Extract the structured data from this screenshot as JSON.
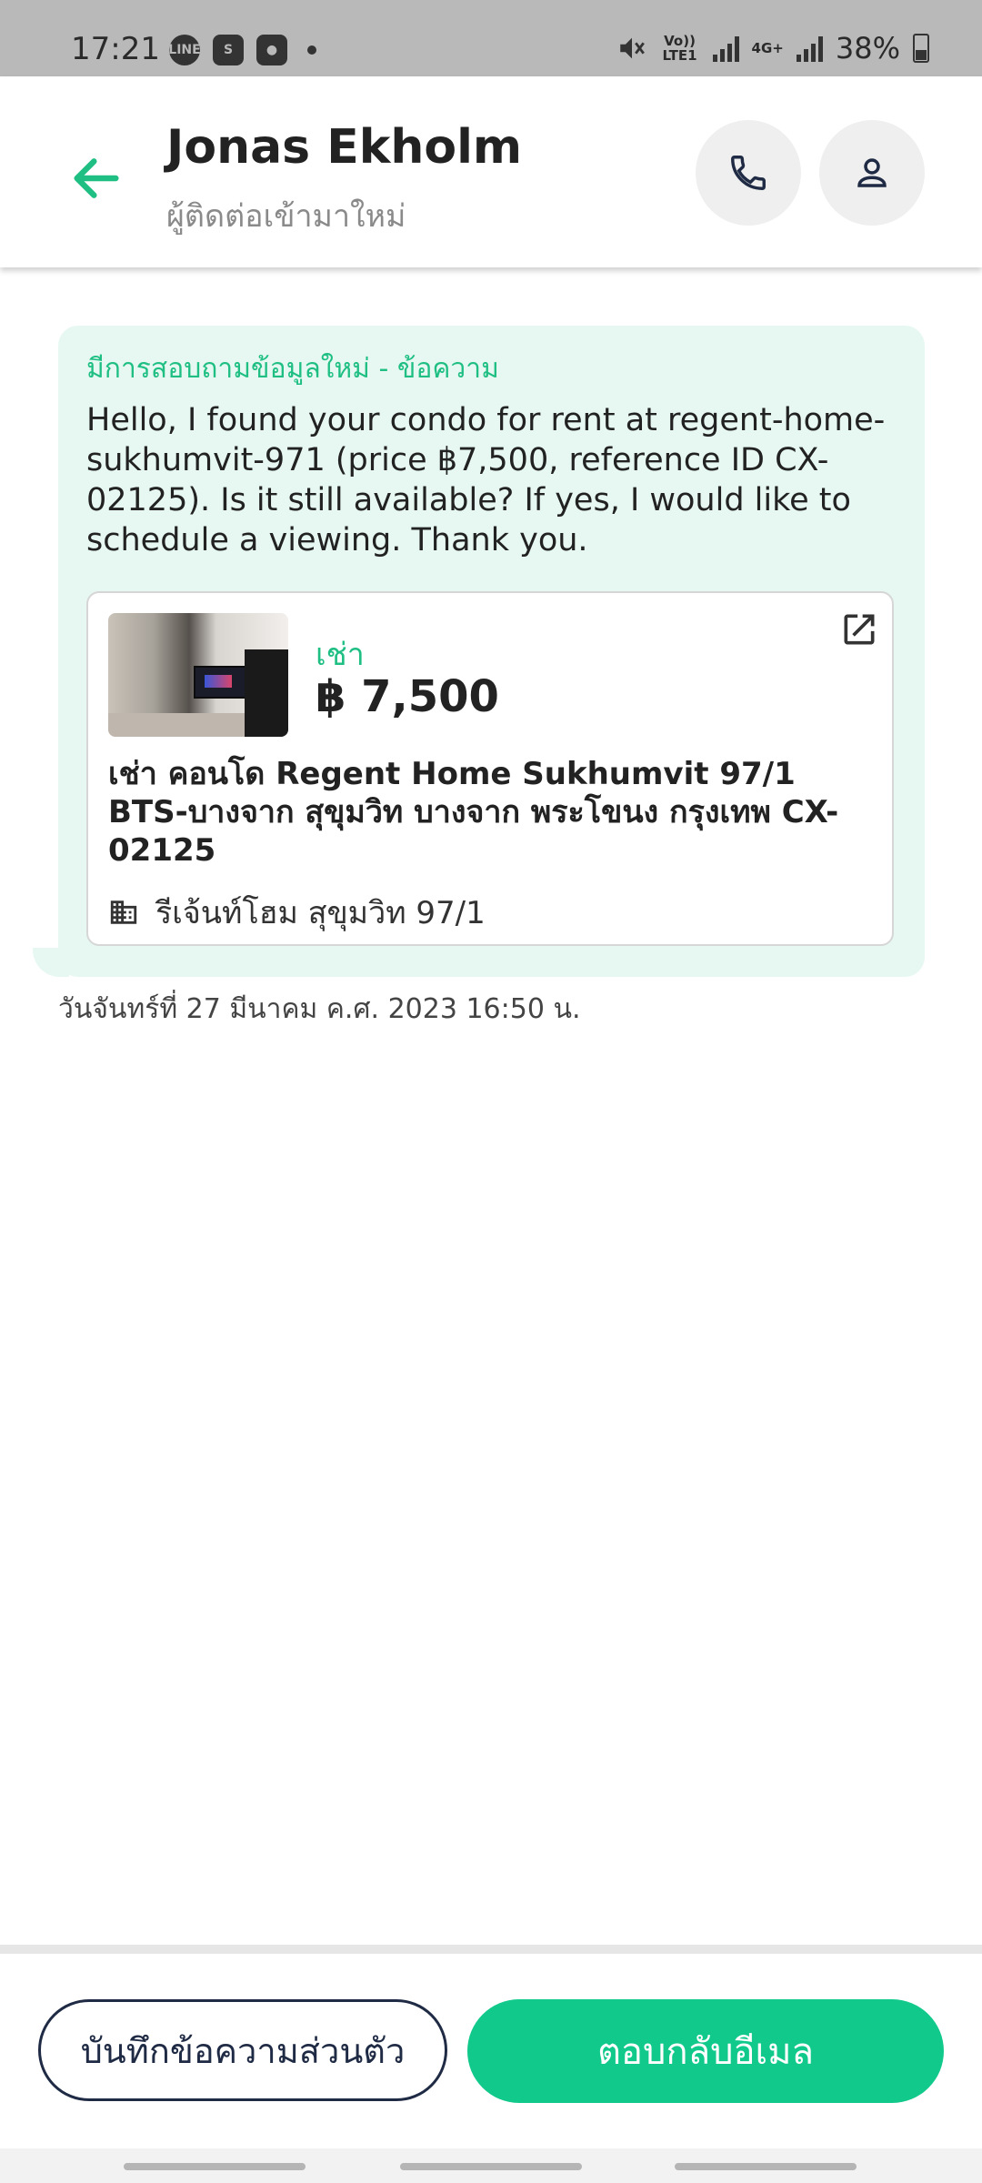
{
  "status_bar": {
    "time": "17:21",
    "notif_icons": [
      "line-icon",
      "shopee-icon",
      "bag-icon"
    ],
    "volte_label": "Vo)) LTE1",
    "network_label": "4G+",
    "battery_percent": "38%"
  },
  "header": {
    "contact_name": "Jonas Ekholm",
    "contact_status": "ผู้ติดต่อเข้ามาใหม่",
    "accent_color": "#1fbf84"
  },
  "message": {
    "title": "มีการสอบถามข้อมูลใหม่ - ข้อความ",
    "body": "Hello, I found your condo for rent at regent-home-sukhumvit-971 (price ฿7,500, reference ID CX-02125). Is it still available? If yes, I would like to schedule a viewing. Thank you.",
    "timestamp": "วันจันทร์ที่ 27 มีนาคม ค.ศ. 2023 16:50 น."
  },
  "listing": {
    "type": "เช่า",
    "price": "฿ 7,500",
    "title": "เช่า คอนโด  Regent Home Sukhumvit 97/1 BTS-บางจาก สุขุมวิท บางจาก พระโขนง กรุงเทพ CX-02125",
    "project": "รีเจ้นท์โฮม สุขุมวิท 97/1"
  },
  "actions": {
    "note_label": "บันทึกข้อความส่วนตัว",
    "reply_label": "ตอบกลับอีเมล"
  }
}
